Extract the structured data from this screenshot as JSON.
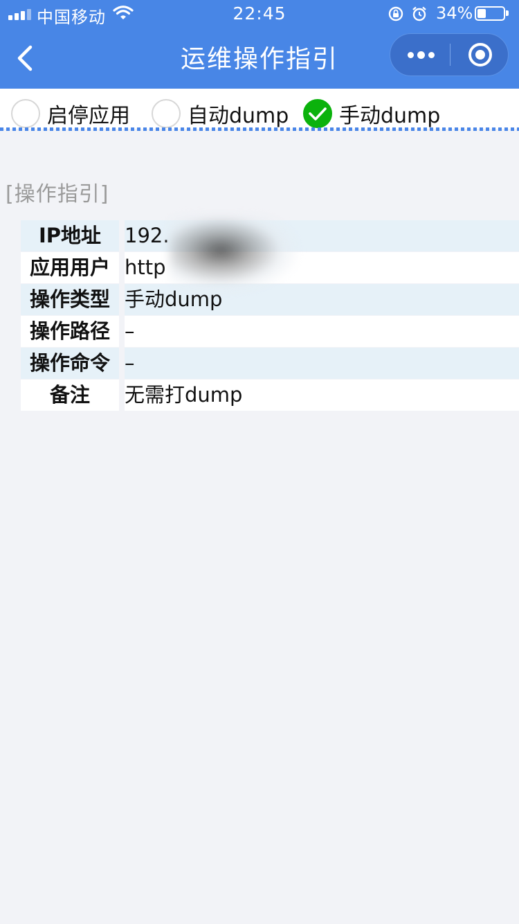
{
  "status_bar": {
    "carrier": "中国移动",
    "time": "22:45",
    "battery_percent": "34%",
    "battery_level": 0.34
  },
  "nav": {
    "title": "运维操作指引"
  },
  "radio_options": [
    {
      "label": "启停应用",
      "checked": false
    },
    {
      "label": "自动dump",
      "checked": false
    },
    {
      "label": "手动dump",
      "checked": true
    }
  ],
  "section": {
    "title": "[操作指引]"
  },
  "info_rows": [
    {
      "key": "IP地址",
      "value": "192."
    },
    {
      "key": "应用用户",
      "value": "http"
    },
    {
      "key": "操作类型",
      "value": "手动dump"
    },
    {
      "key": "操作路径",
      "value": "–"
    },
    {
      "key": "操作命令",
      "value": "–"
    },
    {
      "key": "备注",
      "value": "无需打dump"
    }
  ],
  "colors": {
    "header_bg": "#4886e6",
    "checked_green": "#0bb20c",
    "row_shade": "#e6f1f8",
    "page_bg": "#f2f3f7"
  }
}
